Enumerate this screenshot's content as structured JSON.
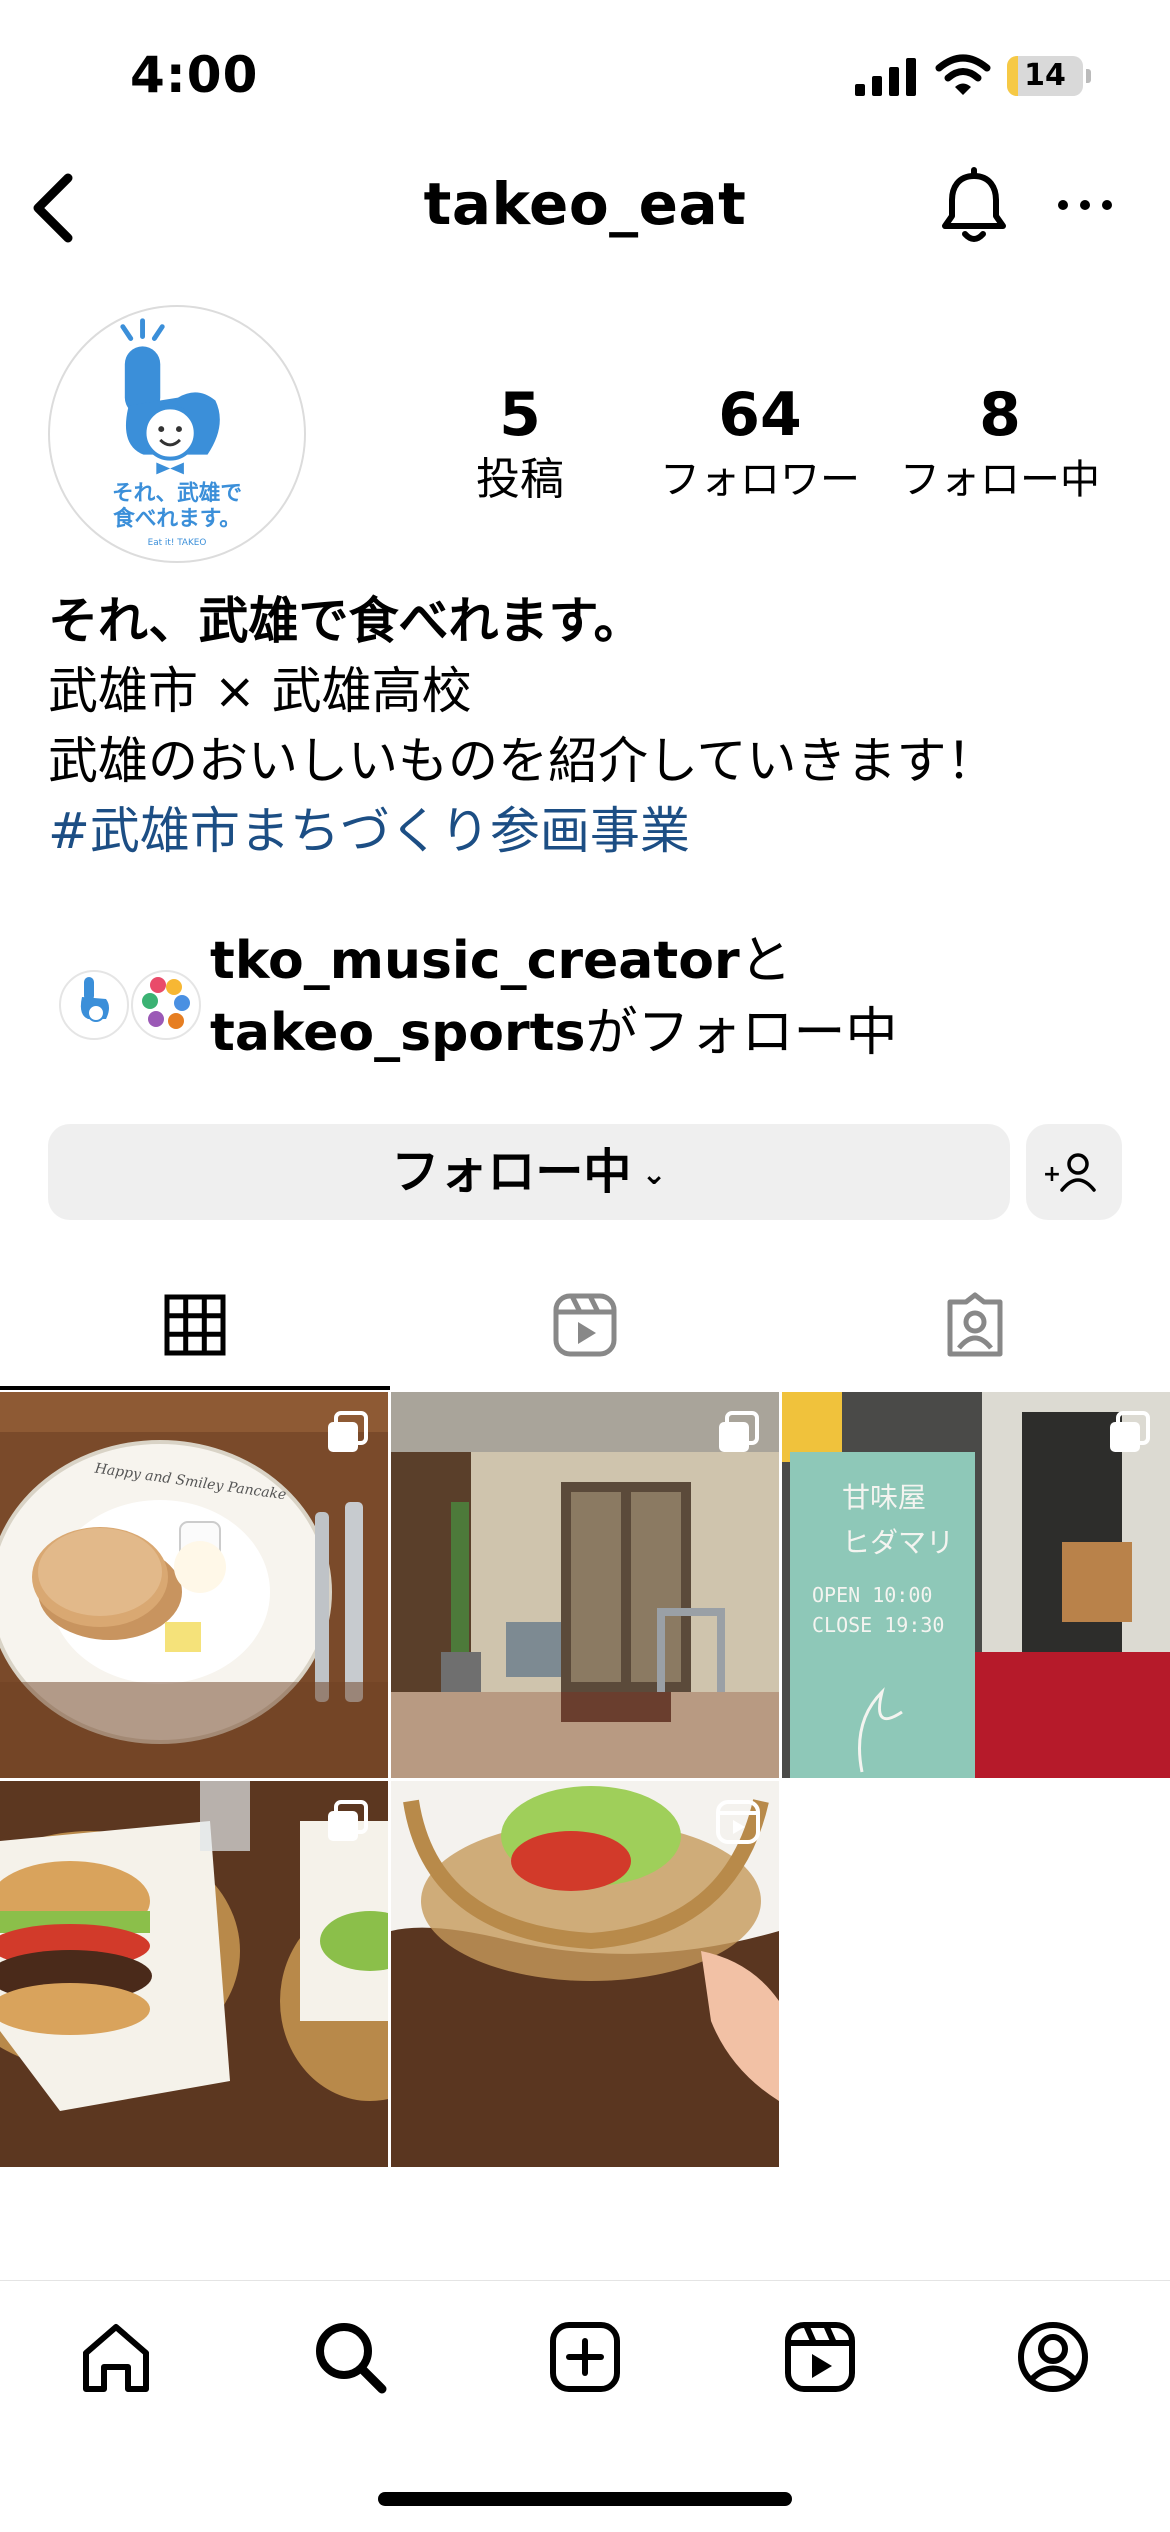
{
  "status_bar": {
    "time": "4:00",
    "battery_level": "14",
    "battery_fraction": 0.14
  },
  "header": {
    "username": "takeo_eat"
  },
  "profile": {
    "avatar_text": "それ、武雄で食べれます。",
    "avatar_subtext": "Eat it! TAKEO",
    "stats": {
      "posts": {
        "value": "5",
        "label": "投稿"
      },
      "followers": {
        "value": "64",
        "label": "フォロワー"
      },
      "following": {
        "value": "8",
        "label": "フォロー中"
      }
    },
    "bio": {
      "title": "それ、武雄で食べれます。",
      "line2": "武雄市 × 武雄高校",
      "line3": "武雄のおいしいものを紹介していきます！",
      "hashtag": "#武雄市まちづくり参画事業"
    },
    "followed_by": {
      "user1": "tko_music_creator",
      "connector": "と",
      "user2": "takeo_sports",
      "suffix": "がフォロー中"
    }
  },
  "actions": {
    "follow_label": "フォロー中"
  },
  "tabs": [
    {
      "name": "posts",
      "icon": "grid-icon",
      "active": true
    },
    {
      "name": "reels",
      "icon": "reels-icon",
      "active": false
    },
    {
      "name": "tagged",
      "icon": "tagged-icon",
      "active": false
    }
  ],
  "posts": [
    {
      "type": "carousel",
      "subject": "pancake",
      "plate_text": "Happy and Smiley Pancake"
    },
    {
      "type": "carousel",
      "subject": "storefront"
    },
    {
      "type": "carousel",
      "subject": "sign",
      "sign_lines": [
        "甘味屋",
        "ヒダマリ",
        "OPEN 10:00",
        "CLOSE 19:30"
      ]
    },
    {
      "type": "carousel",
      "subject": "burger"
    },
    {
      "type": "reel",
      "subject": "burger-basket"
    }
  ],
  "bottom_nav": [
    "home-icon",
    "search-icon",
    "create-icon",
    "reels-icon",
    "profile-icon"
  ],
  "colors": {
    "hashtag": "#1c4e84",
    "button_bg": "#efefef",
    "brand_blue": "#3b8fd9"
  }
}
